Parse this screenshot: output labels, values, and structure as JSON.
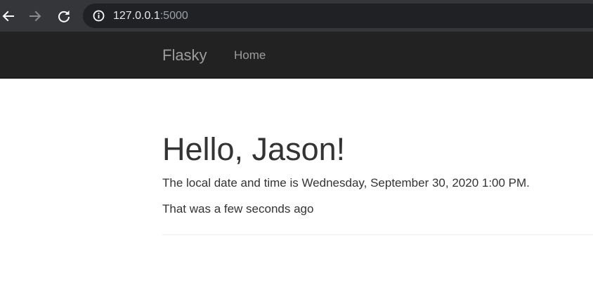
{
  "browser": {
    "url_host": "127.0.0.1",
    "url_port": ":5000",
    "icons": {
      "back": "arrow-left-icon",
      "forward": "arrow-right-icon",
      "reload": "reload-icon",
      "site_info": "info-circle-icon"
    }
  },
  "navbar": {
    "brand": "Flasky",
    "links": [
      {
        "label": "Home"
      }
    ]
  },
  "main": {
    "title": "Hello, Jason!",
    "datetime_line": "The local date and time is Wednesday, September 30, 2020 1:00 PM.",
    "relative_line": "That was a few seconds ago"
  },
  "colors": {
    "toolbar_bg": "#35363a",
    "omnibox_bg": "#202124",
    "navbar_bg": "#222222",
    "navbar_text": "#9d9d9d",
    "body_text": "#333333"
  }
}
